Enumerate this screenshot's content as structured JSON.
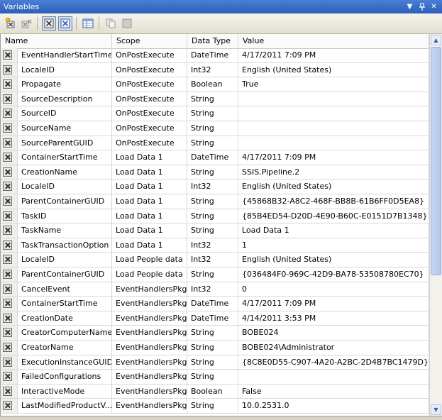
{
  "window": {
    "title": "Variables"
  },
  "toolbar": {
    "buttons": [
      "add-variable",
      "delete-variable",
      "show-system-variables",
      "show-all-variables",
      "choose-columns",
      "copy",
      "paste"
    ]
  },
  "columns": {
    "name": "Name",
    "scope": "Scope",
    "type": "Data Type",
    "value": "Value"
  },
  "rows": [
    {
      "name": "EventHandlerStartTime",
      "scope": "OnPostExecute",
      "type": "DateTime",
      "value": "4/17/2011 7:09 PM"
    },
    {
      "name": "LocaleID",
      "scope": "OnPostExecute",
      "type": "Int32",
      "value": "English (United States)"
    },
    {
      "name": "Propagate",
      "scope": "OnPostExecute",
      "type": "Boolean",
      "value": "True"
    },
    {
      "name": "SourceDescription",
      "scope": "OnPostExecute",
      "type": "String",
      "value": ""
    },
    {
      "name": "SourceID",
      "scope": "OnPostExecute",
      "type": "String",
      "value": ""
    },
    {
      "name": "SourceName",
      "scope": "OnPostExecute",
      "type": "String",
      "value": ""
    },
    {
      "name": "SourceParentGUID",
      "scope": "OnPostExecute",
      "type": "String",
      "value": ""
    },
    {
      "name": "ContainerStartTime",
      "scope": "Load Data 1",
      "type": "DateTime",
      "value": "4/17/2011 7:09 PM"
    },
    {
      "name": "CreationName",
      "scope": "Load Data 1",
      "type": "String",
      "value": "SSIS.Pipeline.2"
    },
    {
      "name": "LocaleID",
      "scope": "Load Data 1",
      "type": "Int32",
      "value": "English (United States)"
    },
    {
      "name": "ParentContainerGUID",
      "scope": "Load Data 1",
      "type": "String",
      "value": "{45868B32-A8C2-468F-BB8B-61B6FF0D5EA8}"
    },
    {
      "name": "TaskID",
      "scope": "Load Data 1",
      "type": "String",
      "value": "{85B4ED54-D20D-4E90-B60C-E0151D7B1348}"
    },
    {
      "name": "TaskName",
      "scope": "Load Data 1",
      "type": "String",
      "value": "Load Data 1"
    },
    {
      "name": "TaskTransactionOption",
      "scope": "Load Data 1",
      "type": "Int32",
      "value": "1"
    },
    {
      "name": "LocaleID",
      "scope": "Load People data",
      "type": "Int32",
      "value": "English (United States)"
    },
    {
      "name": "ParentContainerGUID",
      "scope": "Load People data",
      "type": "String",
      "value": "{036484F0-969C-42D9-BA78-53508780EC70}"
    },
    {
      "name": "CancelEvent",
      "scope": "EventHandlersPkg",
      "type": "Int32",
      "value": "0"
    },
    {
      "name": "ContainerStartTime",
      "scope": "EventHandlersPkg",
      "type": "DateTime",
      "value": "4/17/2011 7:09 PM"
    },
    {
      "name": "CreationDate",
      "scope": "EventHandlersPkg",
      "type": "DateTime",
      "value": "4/14/2011 3:53 PM"
    },
    {
      "name": "CreatorComputerName",
      "scope": "EventHandlersPkg",
      "type": "String",
      "value": "BOBE024"
    },
    {
      "name": "CreatorName",
      "scope": "EventHandlersPkg",
      "type": "String",
      "value": "BOBE024\\Administrator"
    },
    {
      "name": "ExecutionInstanceGUID",
      "scope": "EventHandlersPkg",
      "type": "String",
      "value": "{8C8E0D55-C907-4A20-A2BC-2D4B7BC1479D}"
    },
    {
      "name": "FailedConfigurations",
      "scope": "EventHandlersPkg",
      "type": "String",
      "value": ""
    },
    {
      "name": "InteractiveMode",
      "scope": "EventHandlersPkg",
      "type": "Boolean",
      "value": "False"
    },
    {
      "name": "LastModifiedProductV...",
      "scope": "EventHandlersPkg",
      "type": "String",
      "value": "10.0.2531.0"
    }
  ]
}
